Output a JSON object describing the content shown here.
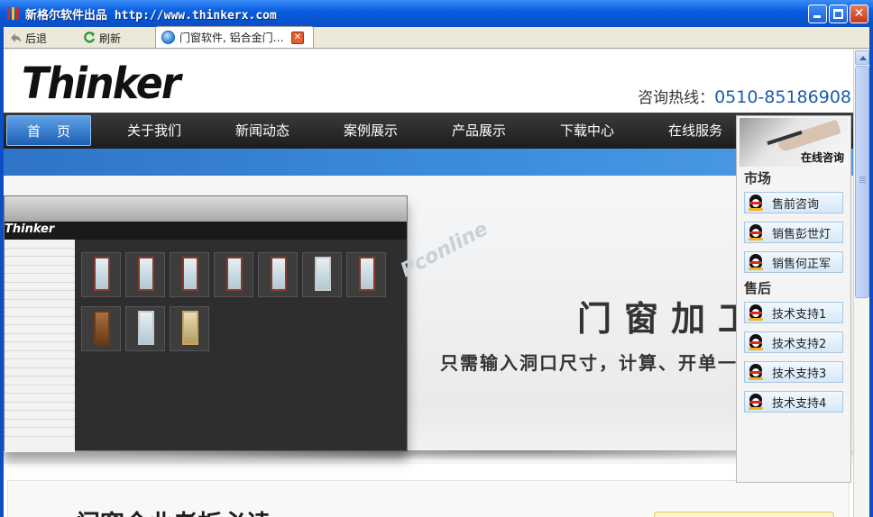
{
  "window": {
    "title": "新格尔软件出品 http://www.thinkerx.com"
  },
  "toolbar": {
    "back_label": "后退",
    "refresh_label": "刷新",
    "tab_title": "门窗软件, 铝合金门…"
  },
  "site": {
    "logo_text": "Thinker",
    "hotline_label": "咨询热线：",
    "hotline_number": "0510-85186908"
  },
  "nav": {
    "items": [
      {
        "label": "首页"
      },
      {
        "label": "关于我们"
      },
      {
        "label": "新闻动态"
      },
      {
        "label": "案例展示"
      },
      {
        "label": "产品展示"
      },
      {
        "label": "下载中心"
      },
      {
        "label": "在线服务"
      }
    ]
  },
  "banner": {
    "title": "门窗加工",
    "subtitle": "只需输入洞口尺寸，计算、开单一",
    "watermark": "Pconline",
    "inner_logo": "Thinker"
  },
  "lower": {
    "title": "门窗企业老板必读"
  },
  "panel": {
    "caption": "在线咨询",
    "market_label": "市场",
    "after_sales_label": "售后",
    "market_items": [
      {
        "label": "售前咨询"
      },
      {
        "label": "销售彭世灯"
      },
      {
        "label": "销售何正军"
      }
    ],
    "support_items": [
      {
        "label": "技术支持1"
      },
      {
        "label": "技术支持2"
      },
      {
        "label": "技术支持3"
      },
      {
        "label": "技术支持4"
      }
    ]
  },
  "colors": {
    "titlebar": "#0a5fe0",
    "nav_bg": "#2a2a2a",
    "nav_active": "#3a82d4",
    "hotline": "#1a5ea8",
    "blue_strip": "#3e8ede"
  }
}
